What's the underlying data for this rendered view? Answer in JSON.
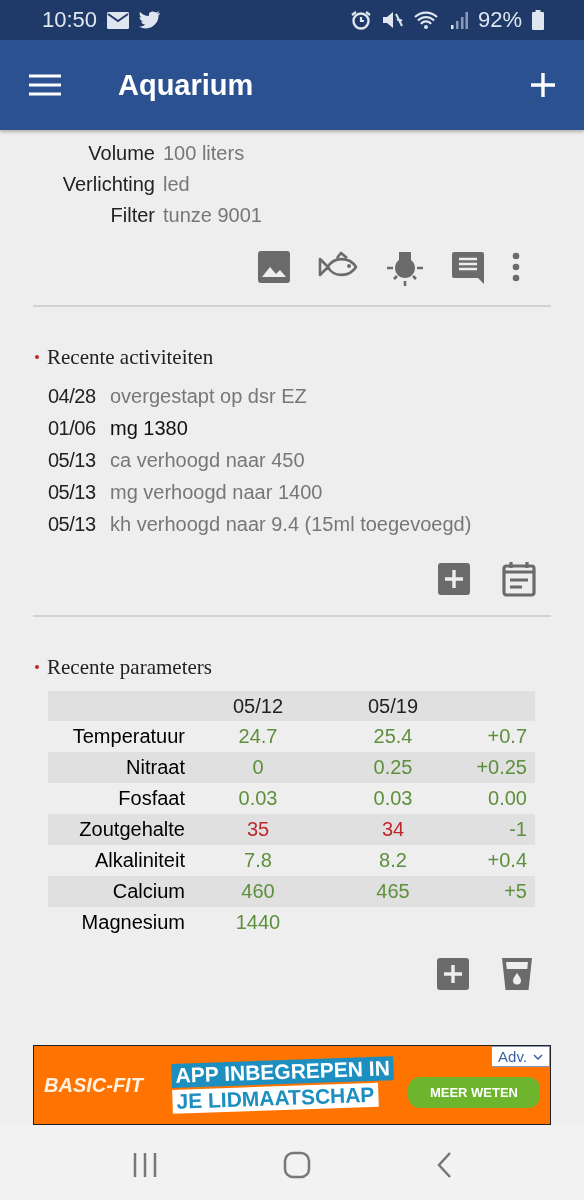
{
  "status_bar": {
    "time": "10:50",
    "battery": "92%"
  },
  "app_bar": {
    "title": "Aquarium"
  },
  "details": [
    {
      "label": "Volume",
      "value": "100 liters"
    },
    {
      "label": "Verlichting",
      "value": "led"
    },
    {
      "label": "Filter",
      "value": "tunze 9001"
    }
  ],
  "activities": {
    "title": "Recente activiteiten",
    "items": [
      {
        "date": "04/28",
        "text": "overgestapt op dsr EZ",
        "emphasized": false
      },
      {
        "date": "01/06",
        "text": "mg 1380",
        "emphasized": true
      },
      {
        "date": "05/13",
        "text": "ca verhoogd naar 450",
        "emphasized": false
      },
      {
        "date": "05/13",
        "text": "mg verhoogd naar 1400",
        "emphasized": false
      },
      {
        "date": "05/13",
        "text": "kh verhoogd naar 9.4 (15ml toegevoegd)",
        "emphasized": false
      }
    ]
  },
  "parameters": {
    "title": "Recente parameters",
    "columns": [
      "05/12",
      "05/19"
    ],
    "rows": [
      {
        "name": "Temperatuur",
        "values": [
          {
            "text": "24.7",
            "color": "#5d8f3c"
          },
          {
            "text": "25.4",
            "color": "#5d8f3c"
          }
        ],
        "change": "+0.7"
      },
      {
        "name": "Nitraat",
        "values": [
          {
            "text": "0",
            "color": "#5d8f3c"
          },
          {
            "text": "0.25",
            "color": "#5d8f3c"
          }
        ],
        "change": "+0.25"
      },
      {
        "name": "Fosfaat",
        "values": [
          {
            "text": "0.03",
            "color": "#5d8f3c"
          },
          {
            "text": "0.03",
            "color": "#5d8f3c"
          }
        ],
        "change": "0.00"
      },
      {
        "name": "Zoutgehalte",
        "values": [
          {
            "text": "35",
            "color": "#c0272d"
          },
          {
            "text": "34",
            "color": "#c0272d"
          }
        ],
        "change": "-1"
      },
      {
        "name": "Alkaliniteit",
        "values": [
          {
            "text": "7.8",
            "color": "#5d8f3c"
          },
          {
            "text": "8.2",
            "color": "#5d8f3c"
          }
        ],
        "change": "+0.4"
      },
      {
        "name": "Calcium",
        "values": [
          {
            "text": "460",
            "color": "#5d8f3c"
          },
          {
            "text": "465",
            "color": "#5d8f3c"
          }
        ],
        "change": "+5"
      },
      {
        "name": "Magnesium",
        "values": [
          {
            "text": "1440",
            "color": "#5d8f3c"
          }
        ]
      }
    ]
  },
  "ad": {
    "brand": "BASIC-FIT",
    "headline": [
      "APP INBEGREPEN IN",
      "JE LIDMAATSCHAP"
    ],
    "button": "MEER WETEN",
    "label": "Adv."
  }
}
